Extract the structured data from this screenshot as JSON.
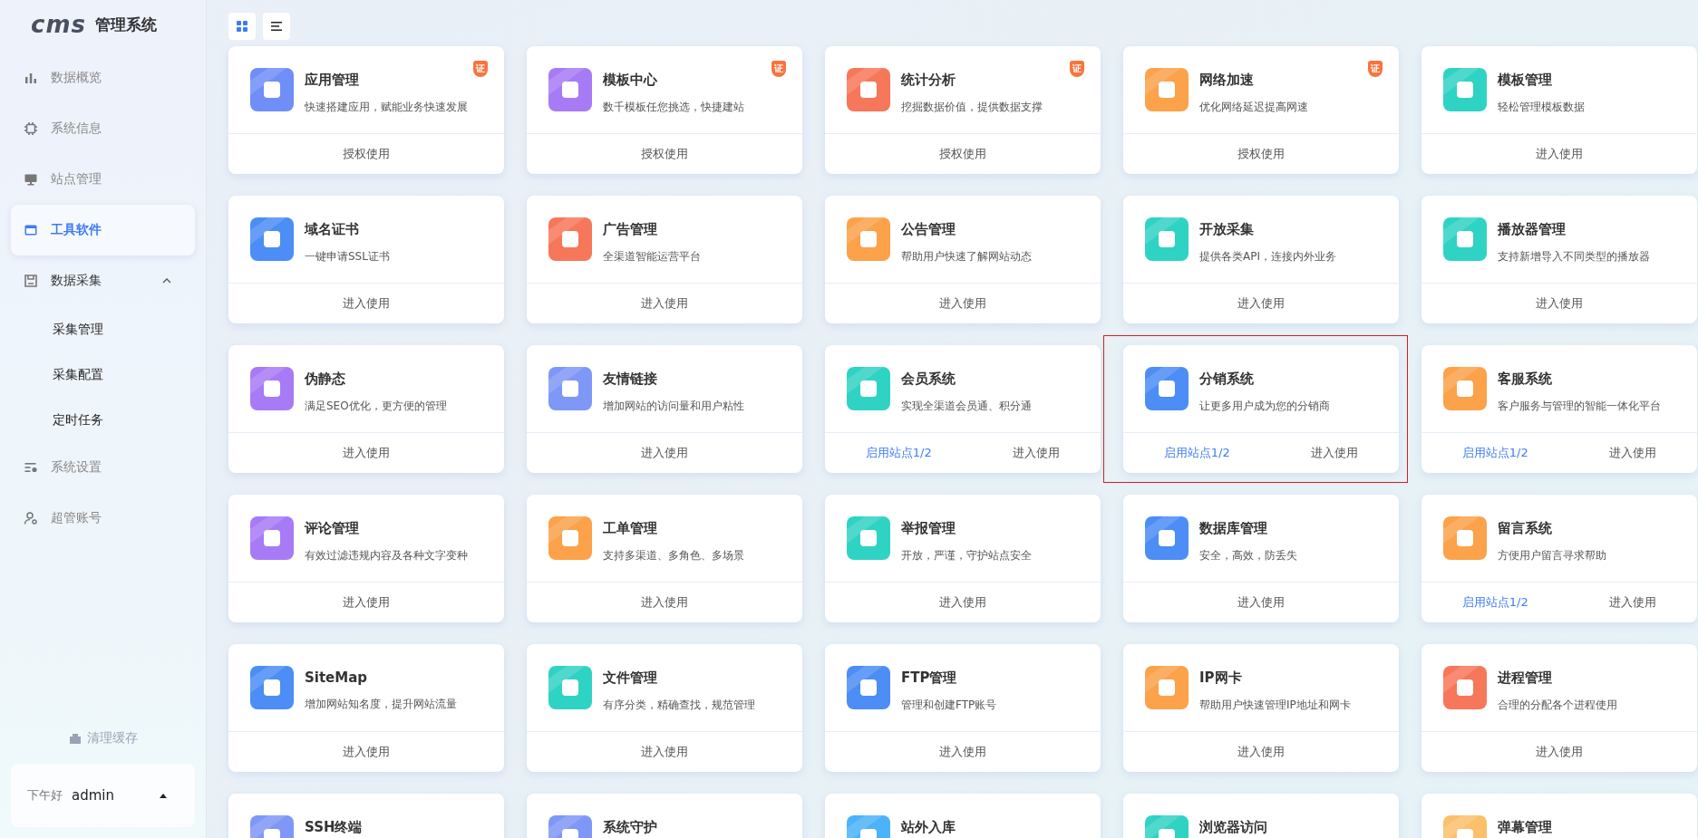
{
  "logo": {
    "mark": "cms",
    "title": "管理系统"
  },
  "sidebar": {
    "items": [
      {
        "label": "数据概览",
        "selected": false
      },
      {
        "label": "系统信息",
        "selected": false
      },
      {
        "label": "站点管理",
        "selected": false
      },
      {
        "label": "工具软件",
        "selected": true
      },
      {
        "label": "数据采集",
        "selected": false,
        "expanded": true,
        "children": [
          {
            "label": "采集管理"
          },
          {
            "label": "采集配置"
          },
          {
            "label": "定时任务"
          }
        ]
      },
      {
        "label": "系统设置",
        "selected": false
      },
      {
        "label": "超管账号",
        "selected": false
      }
    ],
    "clear_cache": "清理缓存",
    "user": {
      "greeting": "下午好",
      "name": "admin"
    }
  },
  "view_toggle": [
    {
      "kind": "grid",
      "selected": true
    },
    {
      "kind": "list",
      "selected": false
    }
  ],
  "cards": [
    {
      "title": "应用管理",
      "desc": "快速搭建应用，赋能业务快速发展",
      "color": "#6f8ef8",
      "badge": "证",
      "highlighted": false,
      "actions": [
        {
          "label": "授权使用",
          "kind": "button"
        }
      ]
    },
    {
      "title": "模板中心",
      "desc": "数千模板任您挑选，快捷建站",
      "color": "#a77bf5",
      "badge": "证",
      "highlighted": false,
      "actions": [
        {
          "label": "授权使用",
          "kind": "button"
        }
      ]
    },
    {
      "title": "统计分析",
      "desc": "挖掘数据价值，提供数据支撑",
      "color": "#f7775a",
      "badge": "证",
      "highlighted": false,
      "actions": [
        {
          "label": "授权使用",
          "kind": "button"
        }
      ]
    },
    {
      "title": "网络加速",
      "desc": "优化网络延迟提高网速",
      "color": "#fba24a",
      "badge": "证",
      "highlighted": false,
      "actions": [
        {
          "label": "授权使用",
          "kind": "button"
        }
      ]
    },
    {
      "title": "模板管理",
      "desc": "轻松管理模板数据",
      "color": "#2fd3c4",
      "highlighted": false,
      "actions": [
        {
          "label": "进入使用",
          "kind": "button"
        }
      ]
    },
    {
      "title": "域名证书",
      "desc": "一键申请SSL证书",
      "color": "#4c8df6",
      "highlighted": false,
      "actions": [
        {
          "label": "进入使用",
          "kind": "button"
        }
      ]
    },
    {
      "title": "广告管理",
      "desc": "全渠道智能运营平台",
      "color": "#f7775a",
      "highlighted": false,
      "actions": [
        {
          "label": "进入使用",
          "kind": "button"
        }
      ]
    },
    {
      "title": "公告管理",
      "desc": "帮助用户快速了解网站动态",
      "color": "#fba24a",
      "highlighted": false,
      "actions": [
        {
          "label": "进入使用",
          "kind": "button"
        }
      ]
    },
    {
      "title": "开放采集",
      "desc": "提供各类API，连接内外业务",
      "color": "#2fd3c4",
      "highlighted": false,
      "actions": [
        {
          "label": "进入使用",
          "kind": "button"
        }
      ]
    },
    {
      "title": "播放器管理",
      "desc": "支持新增导入不同类型的播放器",
      "color": "#2fd3c4",
      "highlighted": false,
      "actions": [
        {
          "label": "进入使用",
          "kind": "button"
        }
      ]
    },
    {
      "title": "伪静态",
      "desc": "满足SEO优化，更方便的管理",
      "color": "#a77bf5",
      "highlighted": false,
      "actions": [
        {
          "label": "进入使用",
          "kind": "button"
        }
      ]
    },
    {
      "title": "友情链接",
      "desc": "增加网站的访问量和用户粘性",
      "color": "#7f97f7",
      "highlighted": false,
      "actions": [
        {
          "label": "进入使用",
          "kind": "button"
        }
      ]
    },
    {
      "title": "会员系统",
      "desc": "实现全渠道会员通、积分通",
      "color": "#2fd3c4",
      "highlighted": false,
      "actions": [
        {
          "label": "启用站点1/2",
          "kind": "link"
        },
        {
          "label": "进入使用",
          "kind": "button"
        }
      ]
    },
    {
      "title": "分销系统",
      "desc": "让更多用户成为您的分销商",
      "color": "#4c8df6",
      "highlighted": true,
      "actions": [
        {
          "label": "启用站点1/2",
          "kind": "link"
        },
        {
          "label": "进入使用",
          "kind": "button"
        }
      ]
    },
    {
      "title": "客服系统",
      "desc": "客户服务与管理的智能一体化平台",
      "color": "#fba24a",
      "highlighted": false,
      "actions": [
        {
          "label": "启用站点1/2",
          "kind": "link"
        },
        {
          "label": "进入使用",
          "kind": "button"
        }
      ]
    },
    {
      "title": "评论管理",
      "desc": "有效过滤违规内容及各种文字变种",
      "color": "#a77bf5",
      "highlighted": false,
      "actions": [
        {
          "label": "进入使用",
          "kind": "button"
        }
      ]
    },
    {
      "title": "工单管理",
      "desc": "支持多渠道、多角色、多场景",
      "color": "#fba24a",
      "highlighted": false,
      "actions": [
        {
          "label": "进入使用",
          "kind": "button"
        }
      ]
    },
    {
      "title": "举报管理",
      "desc": "开放，严谨，守护站点安全",
      "color": "#2fd3c4",
      "highlighted": false,
      "actions": [
        {
          "label": "进入使用",
          "kind": "button"
        }
      ]
    },
    {
      "title": "数据库管理",
      "desc": "安全，高效，防丢失",
      "color": "#4c8df6",
      "highlighted": false,
      "actions": [
        {
          "label": "进入使用",
          "kind": "button"
        }
      ]
    },
    {
      "title": "留言系统",
      "desc": "方便用户留言寻求帮助",
      "color": "#fba24a",
      "highlighted": false,
      "actions": [
        {
          "label": "启用站点1/2",
          "kind": "link"
        },
        {
          "label": "进入使用",
          "kind": "button"
        }
      ]
    },
    {
      "title": "SiteMap",
      "desc": "增加网站知名度，提升网站流量",
      "color": "#4c8df6",
      "highlighted": false,
      "actions": [
        {
          "label": "进入使用",
          "kind": "button"
        }
      ]
    },
    {
      "title": "文件管理",
      "desc": "有序分类，精确查找，规范管理",
      "color": "#2fd3c4",
      "highlighted": false,
      "actions": [
        {
          "label": "进入使用",
          "kind": "button"
        }
      ]
    },
    {
      "title": "FTP管理",
      "desc": "管理和创建FTP账号",
      "color": "#4c8df6",
      "highlighted": false,
      "actions": [
        {
          "label": "进入使用",
          "kind": "button"
        }
      ]
    },
    {
      "title": "IP网卡",
      "desc": "帮助用户快速管理IP地址和网卡",
      "color": "#fba24a",
      "highlighted": false,
      "actions": [
        {
          "label": "进入使用",
          "kind": "button"
        }
      ]
    },
    {
      "title": "进程管理",
      "desc": "合理的分配各个进程使用",
      "color": "#f7775a",
      "highlighted": false,
      "actions": [
        {
          "label": "进入使用",
          "kind": "button"
        }
      ]
    },
    {
      "title": "SSH终端",
      "color": "#7f97f7",
      "highlighted": false
    },
    {
      "title": "系统守护",
      "color": "#7f97f7",
      "highlighted": false
    },
    {
      "title": "站外入库",
      "color": "#4cb3f8",
      "highlighted": false
    },
    {
      "title": "浏览器访问",
      "color": "#2fd3c4",
      "highlighted": false
    },
    {
      "title": "弹幕管理",
      "color": "#fbc06a",
      "highlighted": false
    }
  ]
}
